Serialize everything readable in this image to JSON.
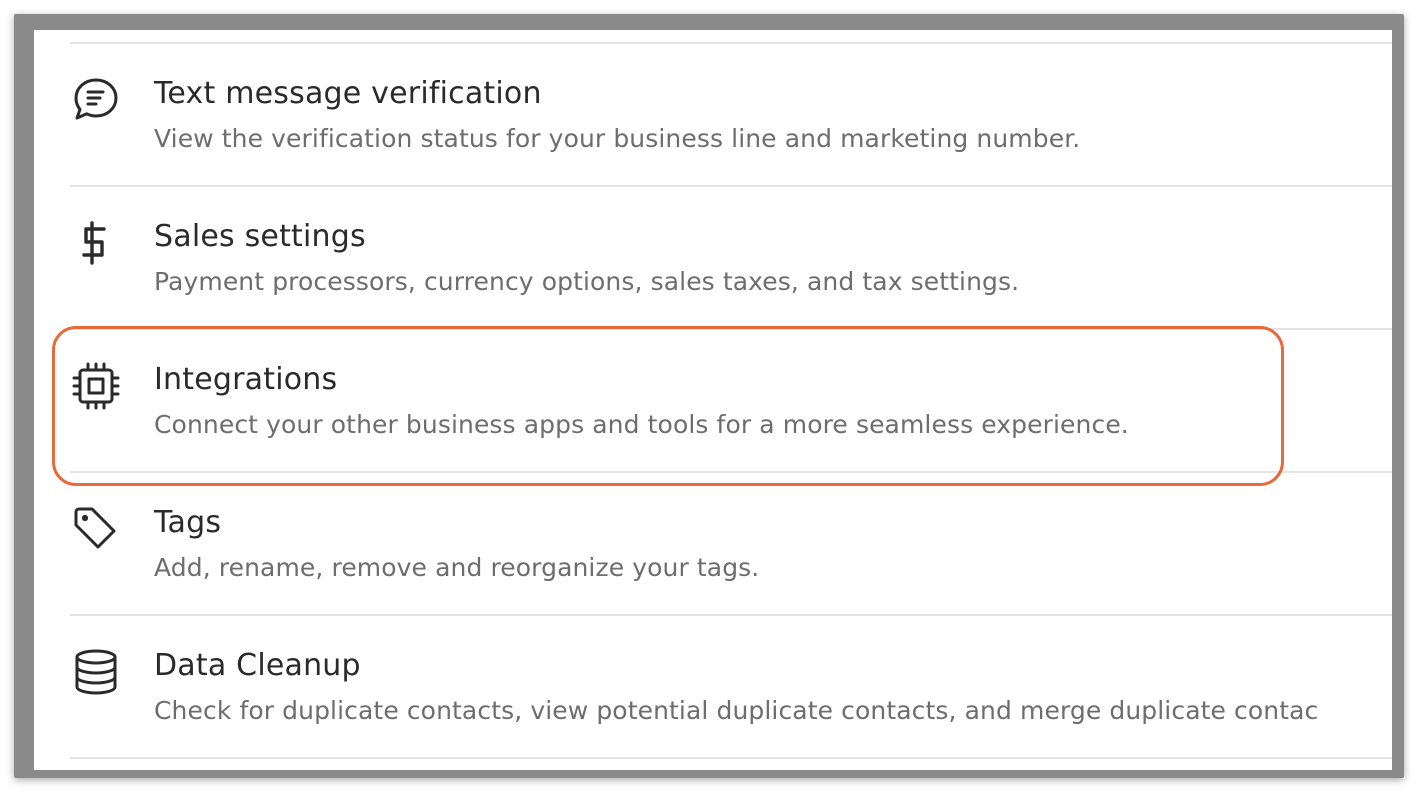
{
  "accent_color": "#e8693a",
  "settings": {
    "items": [
      {
        "icon": "chat-bubble-icon",
        "title": "Text message verification",
        "description": "View the verification status for your business line and marketing number."
      },
      {
        "icon": "dollar-icon",
        "title": "Sales settings",
        "description": "Payment processors, currency options, sales taxes, and tax settings."
      },
      {
        "icon": "chip-icon",
        "title": "Integrations",
        "description": "Connect your other business apps and tools for a more seamless experience."
      },
      {
        "icon": "tag-icon",
        "title": "Tags",
        "description": "Add, rename, remove and reorganize your tags."
      },
      {
        "icon": "database-icon",
        "title": "Data Cleanup",
        "description": "Check for duplicate contacts, view potential duplicate contacts, and merge duplicate contac"
      }
    ]
  }
}
